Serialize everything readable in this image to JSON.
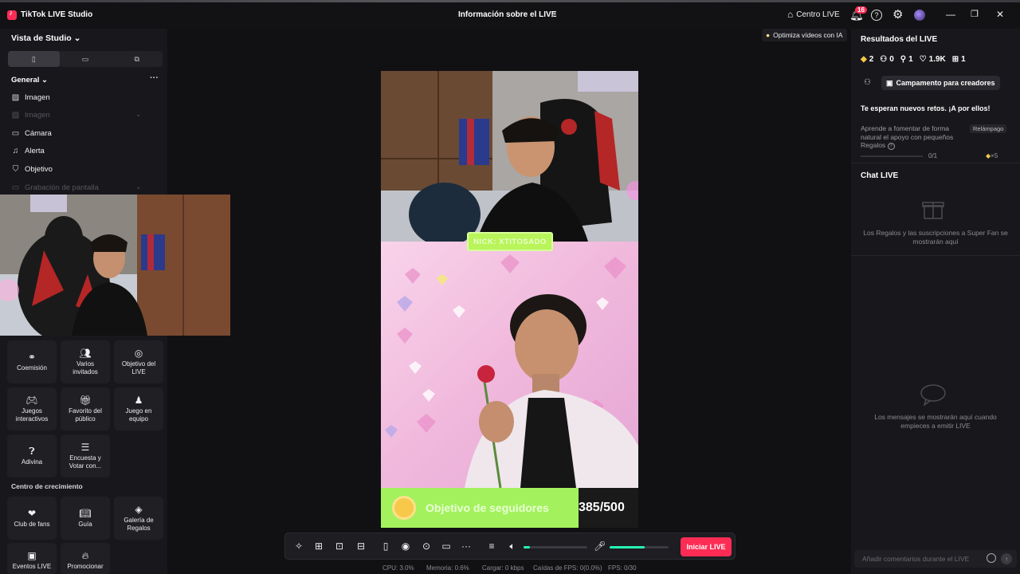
{
  "titlebar": {
    "app_title": "TikTok LIVE Studio",
    "live_info": "Información sobre el LIVE",
    "centro_live": "Centro LIVE",
    "notifications_count": "16"
  },
  "left": {
    "studio_view": "Vista de Studio",
    "general": "General",
    "sources": [
      {
        "label": "Imagen",
        "icon": "image-icon",
        "dim": false
      },
      {
        "label": "Imagen",
        "icon": "image-icon",
        "dim": true
      },
      {
        "label": "Cámara",
        "icon": "camera-icon",
        "dim": false
      },
      {
        "label": "Alerta",
        "icon": "bell-icon",
        "dim": false
      },
      {
        "label": "Objetivo",
        "icon": "target-icon",
        "dim": false
      },
      {
        "label": "Grabación de pantalla",
        "icon": "monitor-icon",
        "dim": true
      }
    ],
    "tools": [
      {
        "label": "Coemisión",
        "icon": "link-icon"
      },
      {
        "label": "Varios invitados",
        "icon": "users-icon"
      },
      {
        "label": "Objetivo del LIVE",
        "icon": "goal-icon"
      },
      {
        "label": "Juegos interactivos",
        "icon": "gamepad-icon"
      },
      {
        "label": "Favorito del público",
        "icon": "gift-icon"
      },
      {
        "label": "Juego en equipo",
        "icon": "team-icon"
      },
      {
        "label": "Adivina",
        "icon": "question-icon"
      },
      {
        "label": "Encuesta y Votar con...",
        "icon": "poll-icon"
      }
    ],
    "growth_title": "Centro de crecimiento",
    "growth": [
      {
        "label": "Club de fans",
        "icon": "heart-icon"
      },
      {
        "label": "Guía",
        "icon": "book-icon"
      },
      {
        "label": "Galería de Regalos",
        "icon": "gem-icon"
      },
      {
        "label": "Eventos LIVE",
        "icon": "calendar-icon"
      },
      {
        "label": "Promocionar",
        "icon": "flame-icon"
      }
    ]
  },
  "center": {
    "ai_optimize": "Optimiza vídeos con IA",
    "nickname": "NICK: XTITOSADO",
    "goal_label": "Objetivo de seguidores",
    "goal_count": "385/500",
    "start_live": "Iniciar LIVE",
    "speaker_level": 0.1,
    "mic_level": 0.6
  },
  "stats": {
    "cpu": "CPU:  3.0%",
    "memory": "Memoria:  0.6%",
    "upload": "Cargar:  0 kbps",
    "fps_drop": "Caídas de FPS:  0(0.0%)",
    "fps": "FPS:  0/30"
  },
  "right": {
    "results_title": "Resultados del LIVE",
    "stat_gems": "2",
    "stat_users": "0",
    "stat_shares": "1",
    "stat_likes": "1.9K",
    "stat_gifts": "1",
    "campaign": "Campamento para creadores",
    "challenge": "Te esperan nuevos retos. ¡A por ellos!",
    "learn": "Aprende a fomentar de forma natural el apoyo con pequeños Regalos",
    "lightning": "Relámpago",
    "progress": "0/1",
    "reward": "×5",
    "chat_title": "Chat LIVE",
    "gifts_empty": "Los Regalos y las suscripciones a Super Fan se mostrarán aquí",
    "messages_empty": "Los mensajes se mostrarán aquí cuando empieces a emitir LIVE",
    "chat_placeholder": "Añadir comentarios durante el LIVE"
  },
  "colors": {
    "accent": "#fe2c55",
    "meter": "#25f4b4",
    "goal": "#a3f25d"
  }
}
